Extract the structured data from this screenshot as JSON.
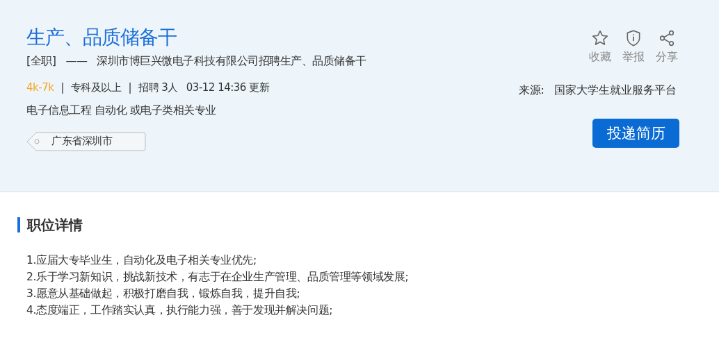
{
  "job": {
    "title": "生产、品质储备干",
    "type": "[全职]",
    "dash": "——",
    "company": "深圳市博巨兴微电子科技有限公司招聘生产、品质储备干",
    "salary": "4k-7k",
    "education": "专科及以上",
    "headcount": "招聘 3人",
    "updated": "03-12 14:36 更新",
    "majors": "电子信息工程 自动化 或电子类相关专业",
    "location": "广东省深圳市",
    "separator": "|"
  },
  "actions": [
    {
      "kind": "star",
      "label": "收藏"
    },
    {
      "kind": "shield",
      "label": "举报"
    },
    {
      "kind": "share",
      "label": "分享"
    }
  ],
  "source": {
    "label": "来源:",
    "value": "国家大学生就业服务平台"
  },
  "apply_button": "投递简历",
  "details": {
    "heading": "职位详情",
    "lines": [
      "1.应届大专毕业生，自动化及电子相关专业优先;",
      "2.乐于学习新知识，挑战新技术，有志于在企业生产管理、品质管理等领域发展;",
      "3.愿意从基础做起，积极打磨自我，锻炼自我，提升自我;",
      "4.态度端正，工作踏实认真，执行能力强，善于发现并解决问题;"
    ]
  }
}
